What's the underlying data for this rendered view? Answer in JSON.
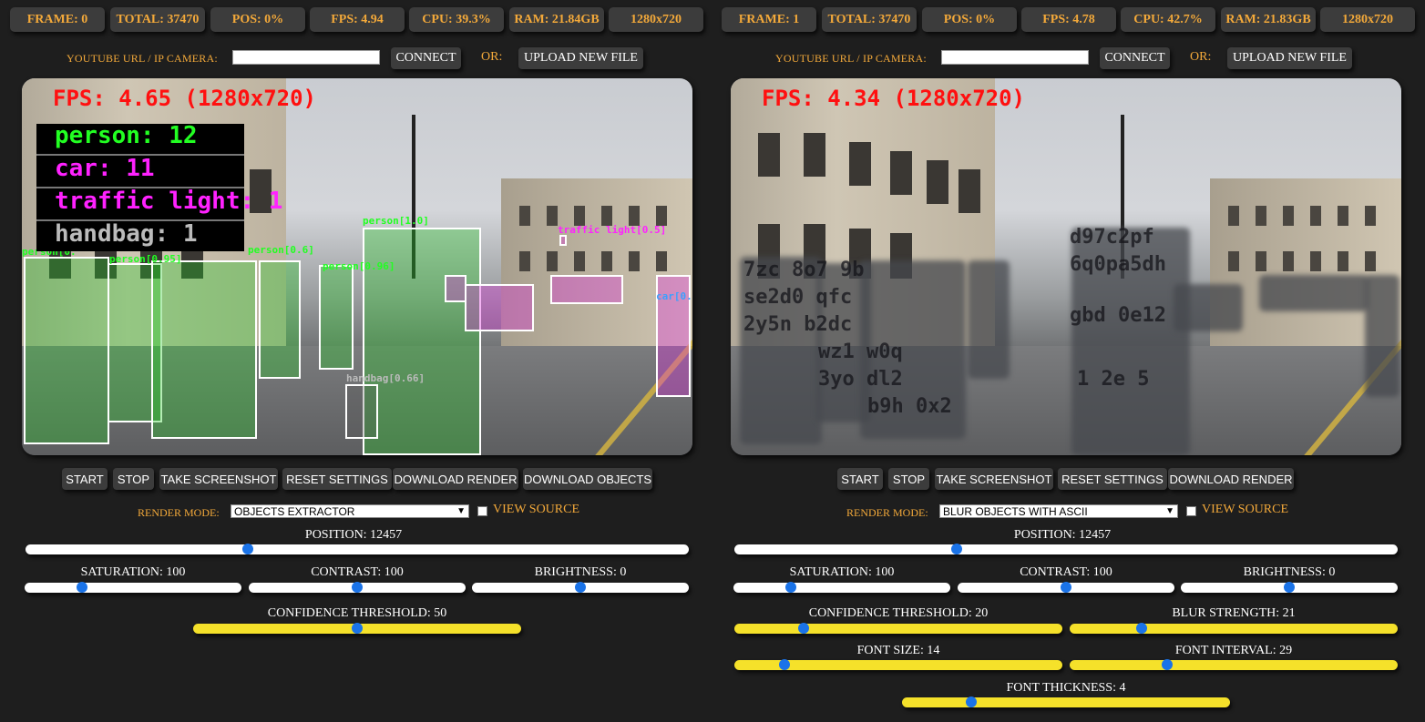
{
  "panels": [
    {
      "stats": [
        "FRAME: 0",
        "TOTAL: 37470",
        "POS: 0%",
        "FPS: 4.94",
        "CPU: 39.3%",
        "RAM: 21.84GB",
        "1280x720"
      ],
      "source": {
        "label": "YOUTUBE URL / IP CAMERA:",
        "url_value": "",
        "connect": "CONNECT",
        "or": "OR:",
        "upload": "UPLOAD NEW FILE"
      },
      "video": {
        "fps_overlay": "FPS: 4.65 (1280x720)",
        "counts": [
          {
            "text": "person: 12",
            "color": "#22ff22"
          },
          {
            "text": "car: 11",
            "color": "#ff22ff"
          },
          {
            "text": "traffic light: 1",
            "color": "#ff22ff"
          },
          {
            "text": "handbag: 1",
            "color": "#bbbbbb"
          }
        ],
        "labels": [
          "person[1.0]",
          "traffic light[0.5]",
          "person[0.6]",
          "handbag[0.66]",
          "car[0.]",
          "person[0.",
          "person[0.95]",
          "person[0.96]"
        ]
      },
      "buttons": [
        "START",
        "STOP",
        "TAKE SCREENSHOT",
        "RESET SETTINGS",
        "DOWNLOAD RENDER",
        "DOWNLOAD OBJECTS"
      ],
      "render_mode_label": "RENDER MODE:",
      "render_mode": "OBJECTS EXTRACTOR",
      "view_source": "VIEW SOURCE",
      "view_source_checked": false,
      "sliders": {
        "position": {
          "label": "POSITION: 12457",
          "value": 12457,
          "max": 37470
        },
        "saturation": {
          "label": "SATURATION: 100",
          "value": 100,
          "max": 400
        },
        "contrast": {
          "label": "CONTRAST: 100",
          "value": 100,
          "max": 200
        },
        "brightness": {
          "label": "BRIGHTNESS: 0",
          "value": 0,
          "min": -100,
          "max": 100
        },
        "confidence": {
          "label": "CONFIDENCE THRESHOLD: 50",
          "value": 50,
          "max": 100
        }
      }
    },
    {
      "stats": [
        "FRAME: 1",
        "TOTAL: 37470",
        "POS: 0%",
        "FPS: 4.78",
        "CPU: 42.7%",
        "RAM: 21.83GB",
        "1280x720"
      ],
      "source": {
        "label": "YOUTUBE URL / IP CAMERA:",
        "url_value": "",
        "connect": "CONNECT",
        "or": "OR:",
        "upload": "UPLOAD NEW FILE"
      },
      "video": {
        "fps_overlay": "FPS: 4.34 (1280x720)",
        "ascii_text": [
          "d97c2pf",
          "6q0pa5dh",
          "7zc 8o7 9b",
          "se2d0 qfc",
          "2y5n b2dc",
          "gbd 0e12",
          "wz1 w0q",
          "3yo dl2",
          "b9h 0x2",
          "1 2e 5"
        ]
      },
      "buttons": [
        "START",
        "STOP",
        "TAKE SCREENSHOT",
        "RESET SETTINGS",
        "DOWNLOAD RENDER"
      ],
      "render_mode_label": "RENDER MODE:",
      "render_mode": "BLUR OBJECTS WITH ASCII",
      "view_source": "VIEW SOURCE",
      "view_source_checked": false,
      "sliders": {
        "position": {
          "label": "POSITION: 12457",
          "value": 12457,
          "max": 37470
        },
        "saturation": {
          "label": "SATURATION: 100",
          "value": 100,
          "max": 400
        },
        "contrast": {
          "label": "CONTRAST: 100",
          "value": 100,
          "max": 200
        },
        "brightness": {
          "label": "BRIGHTNESS: 0",
          "value": 0,
          "min": -100,
          "max": 100
        },
        "confidence": {
          "label": "CONFIDENCE THRESHOLD: 20",
          "value": 20,
          "max": 100
        },
        "blur_strength": {
          "label": "BLUR STRENGTH: 21",
          "value": 21,
          "max": 100
        },
        "font_size": {
          "label": "FONT SIZE: 14",
          "value": 14,
          "max": 100
        },
        "font_interval": {
          "label": "FONT INTERVAL: 29",
          "value": 29,
          "max": 100
        },
        "font_thickness": {
          "label": "FONT THICKNESS: 4",
          "value": 4,
          "max": 20
        }
      }
    }
  ]
}
